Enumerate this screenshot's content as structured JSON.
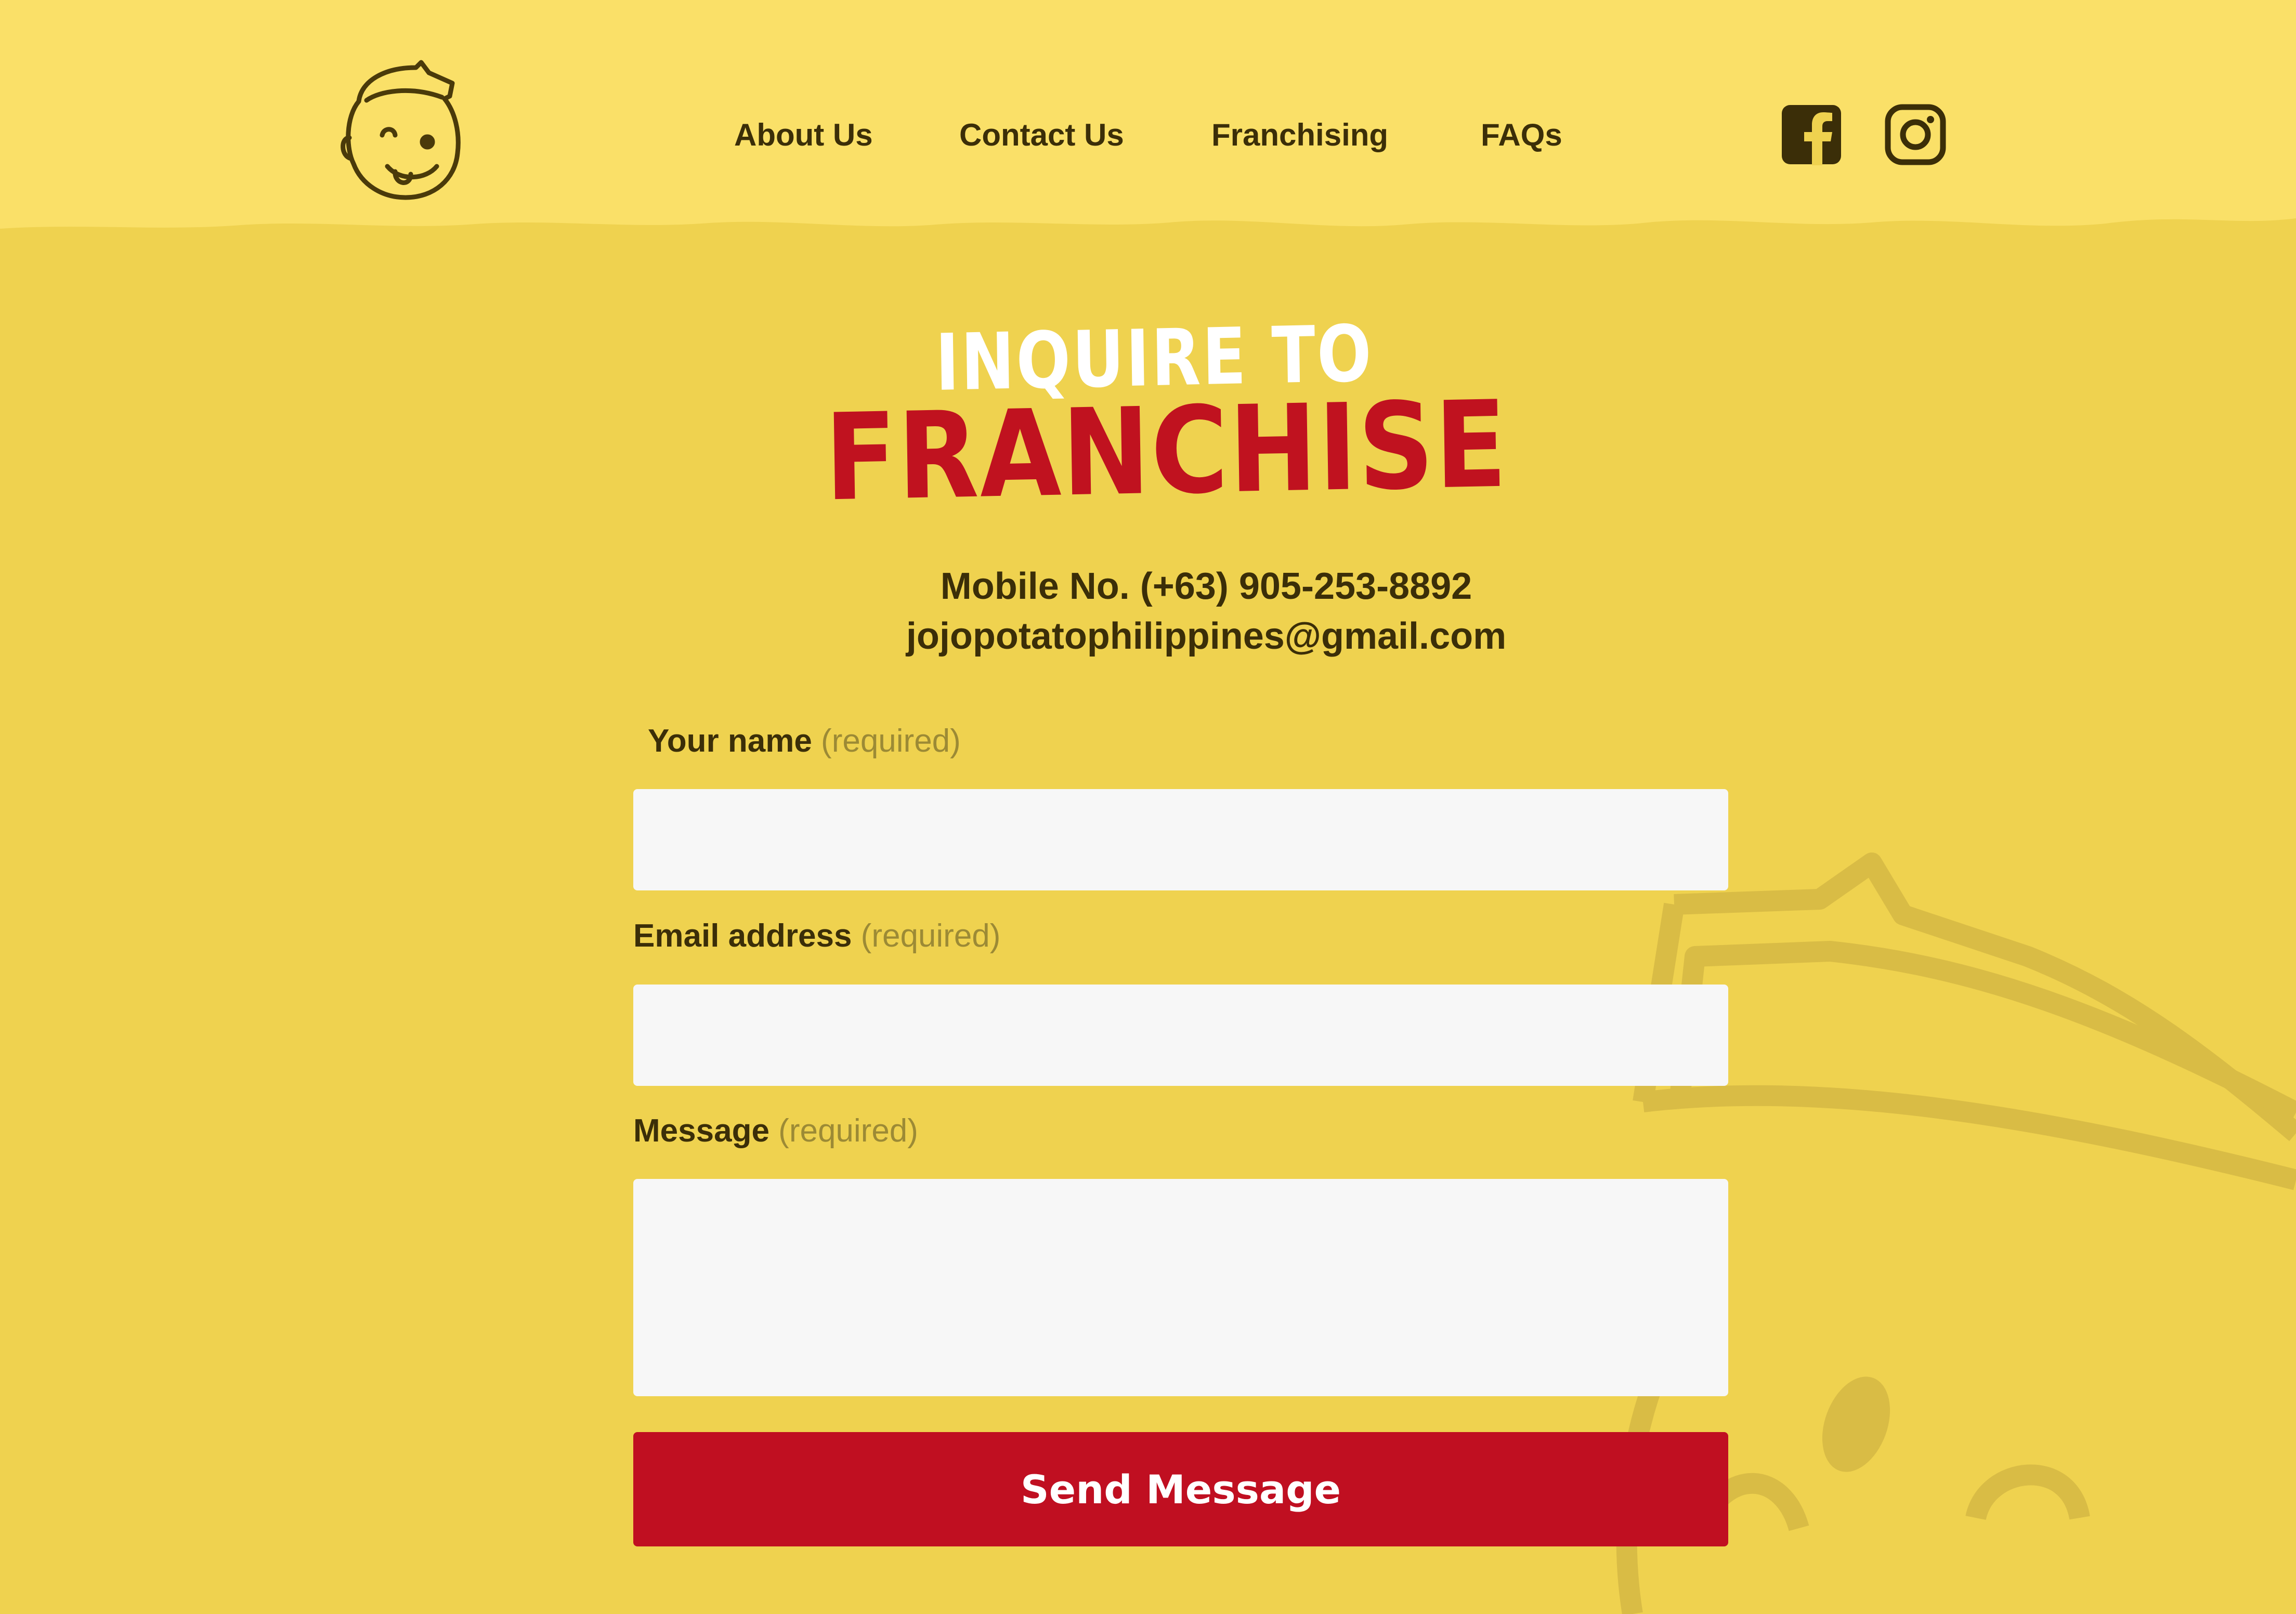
{
  "header": {
    "logo_icon": "mascot-logo-icon",
    "nav": [
      {
        "label": "About Us"
      },
      {
        "label": "Contact Us"
      },
      {
        "label": "Franchising"
      },
      {
        "label": "FAQs"
      }
    ],
    "social": [
      {
        "icon": "facebook-icon"
      },
      {
        "icon": "instagram-icon"
      }
    ]
  },
  "heading": {
    "line1": "INQUIRE TO",
    "line2": "FRANCHISE"
  },
  "contact": {
    "mobile": "Mobile No. (+63) 905-253-8892",
    "email": "jojopotatophilippines@gmail.com"
  },
  "form": {
    "name": {
      "label": "Your name",
      "required": "(required)",
      "value": ""
    },
    "email": {
      "label": "Email address",
      "required": "(required)",
      "value": ""
    },
    "message": {
      "label": "Message",
      "required": "(required)",
      "value": ""
    },
    "submit_label": "Send Message"
  },
  "colors": {
    "background": "#efd24f",
    "header_background": "#fae068",
    "text": "#3b2e08",
    "accent_red": "#c00f21",
    "input_background": "#f7f7f7"
  }
}
